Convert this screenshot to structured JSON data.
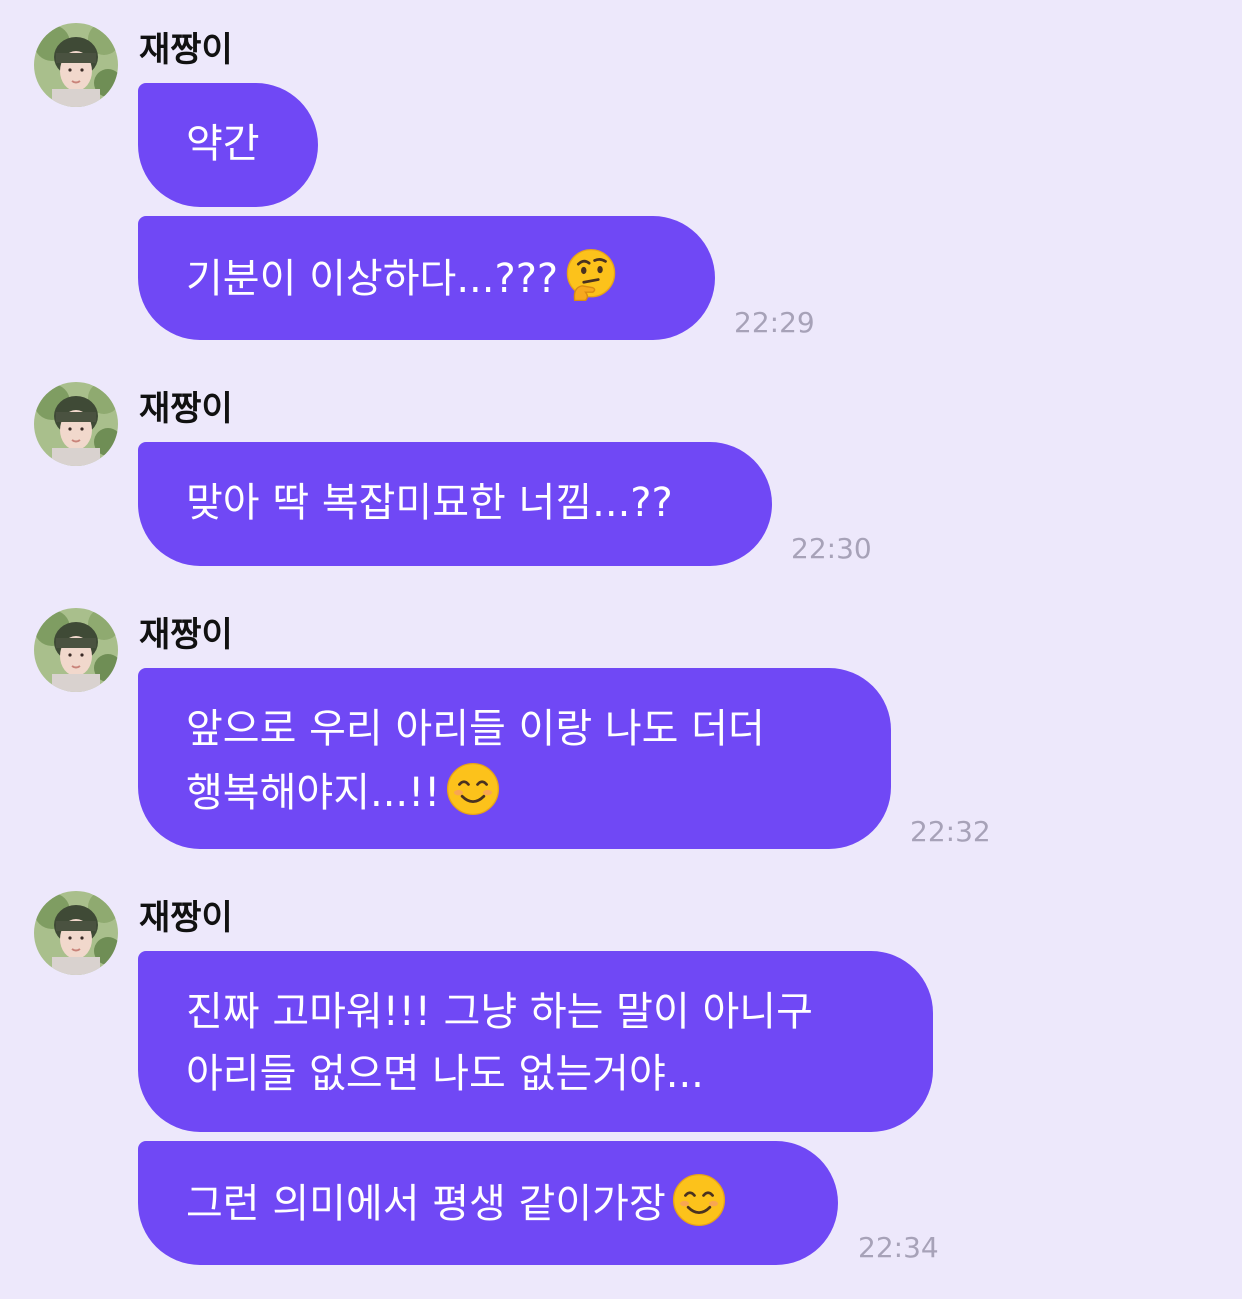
{
  "colors": {
    "background": "#ede8fb",
    "bubble": "#7048f5",
    "bubble_text": "#ffffff",
    "sender_text": "#111111",
    "timestamp": "#a7a2b8"
  },
  "groups": [
    {
      "sender": "재짱이",
      "messages": [
        {
          "lines": [
            "약간"
          ],
          "emoji": null
        },
        {
          "lines": [
            "기분이 이상하다...???"
          ],
          "emoji": "thinking-face-emoji"
        }
      ],
      "time": "22:29"
    },
    {
      "sender": "재짱이",
      "messages": [
        {
          "lines": [
            "맞아 딱 복잡미묘한 너낌...??"
          ],
          "emoji": null
        }
      ],
      "time": "22:30"
    },
    {
      "sender": "재짱이",
      "messages": [
        {
          "lines": [
            "앞으로 우리 아리들 이랑 나도 더더",
            "행복해야지...!!"
          ],
          "emoji": "smiling-face-emoji"
        }
      ],
      "time": "22:32"
    },
    {
      "sender": "재짱이",
      "messages": [
        {
          "lines": [
            "진짜 고마워!!! 그냥 하는 말이 아니구",
            "아리들 없으면 나도 없는거야..."
          ],
          "emoji": null
        },
        {
          "lines": [
            "그런 의미에서 평생 같이가장"
          ],
          "emoji": "smiling-face-emoji"
        }
      ],
      "time": "22:34"
    }
  ]
}
